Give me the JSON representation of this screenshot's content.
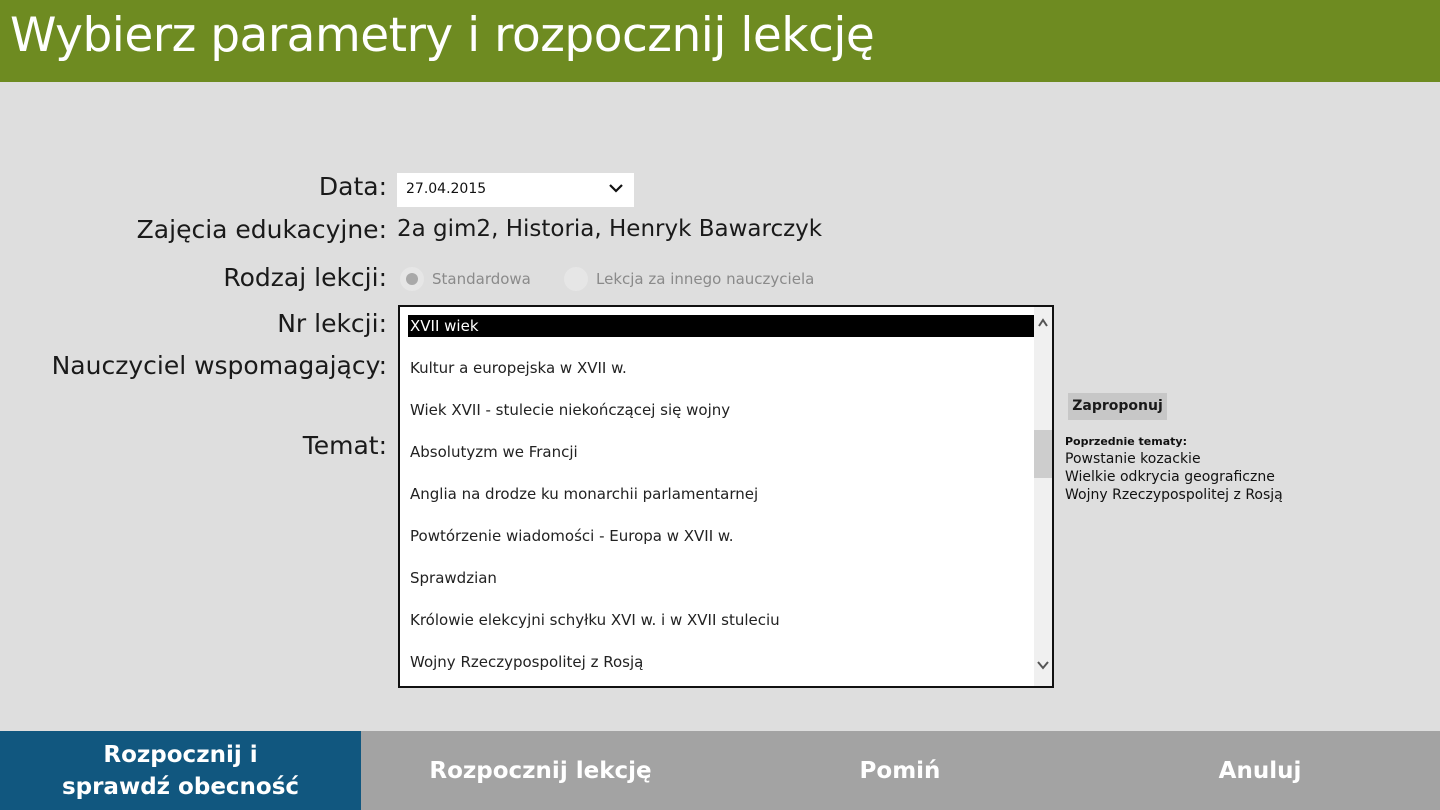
{
  "header": {
    "title": "Wybierz parametry i rozpocznij lekcję"
  },
  "form": {
    "labels": {
      "date": "Data:",
      "class": "Zajęcia edukacyjne:",
      "lesson_type": "Rodzaj lekcji:",
      "lesson_number": "Nr lekcji:",
      "assistant_teacher": "Nauczyciel wspomagający:",
      "topic": "Temat:"
    },
    "date_value": "27.04.2015",
    "class_value": "2a gim2, Historia, Henryk Bawarczyk",
    "lesson_type_options": [
      {
        "label": "Standardowa",
        "checked": true
      },
      {
        "label": "Lekcja za innego nauczyciela",
        "checked": false
      }
    ]
  },
  "topics_list": {
    "selected_index": 0,
    "items": [
      "XVII wiek",
      "Kultur a europejska w XVII w.",
      "Wiek XVII - stulecie niekończącej się wojny",
      "Absolutyzm we Francji",
      "Anglia na drodze ku monarchii parlamentarnej",
      "Powtórzenie wiadomości - Europa w XVII w.",
      "Sprawdzian",
      "Królowie elekcyjni schyłku XVI w. i w XVII stuleciu",
      "Wojny Rzeczypospolitej z Rosją"
    ],
    "scroll_position": 0.35
  },
  "side": {
    "propose_label": "Zaproponuj",
    "prev_title": "Poprzednie tematy:",
    "prev_topics": [
      "Powstanie kozackie",
      "Wielkie odkrycia geograficzne",
      "Wojny Rzeczypospolitej z Rosją"
    ]
  },
  "footer": {
    "start_check_line1": "Rozpocznij i",
    "start_check_line2": "sprawdź obecność",
    "start": "Rozpocznij lekcję",
    "skip": "Pomiń",
    "cancel": "Anuluj"
  },
  "colors": {
    "header": "#6e8b21",
    "primary_button": "#11577f",
    "secondary_button": "#a3a3a3",
    "background": "#dedede"
  }
}
